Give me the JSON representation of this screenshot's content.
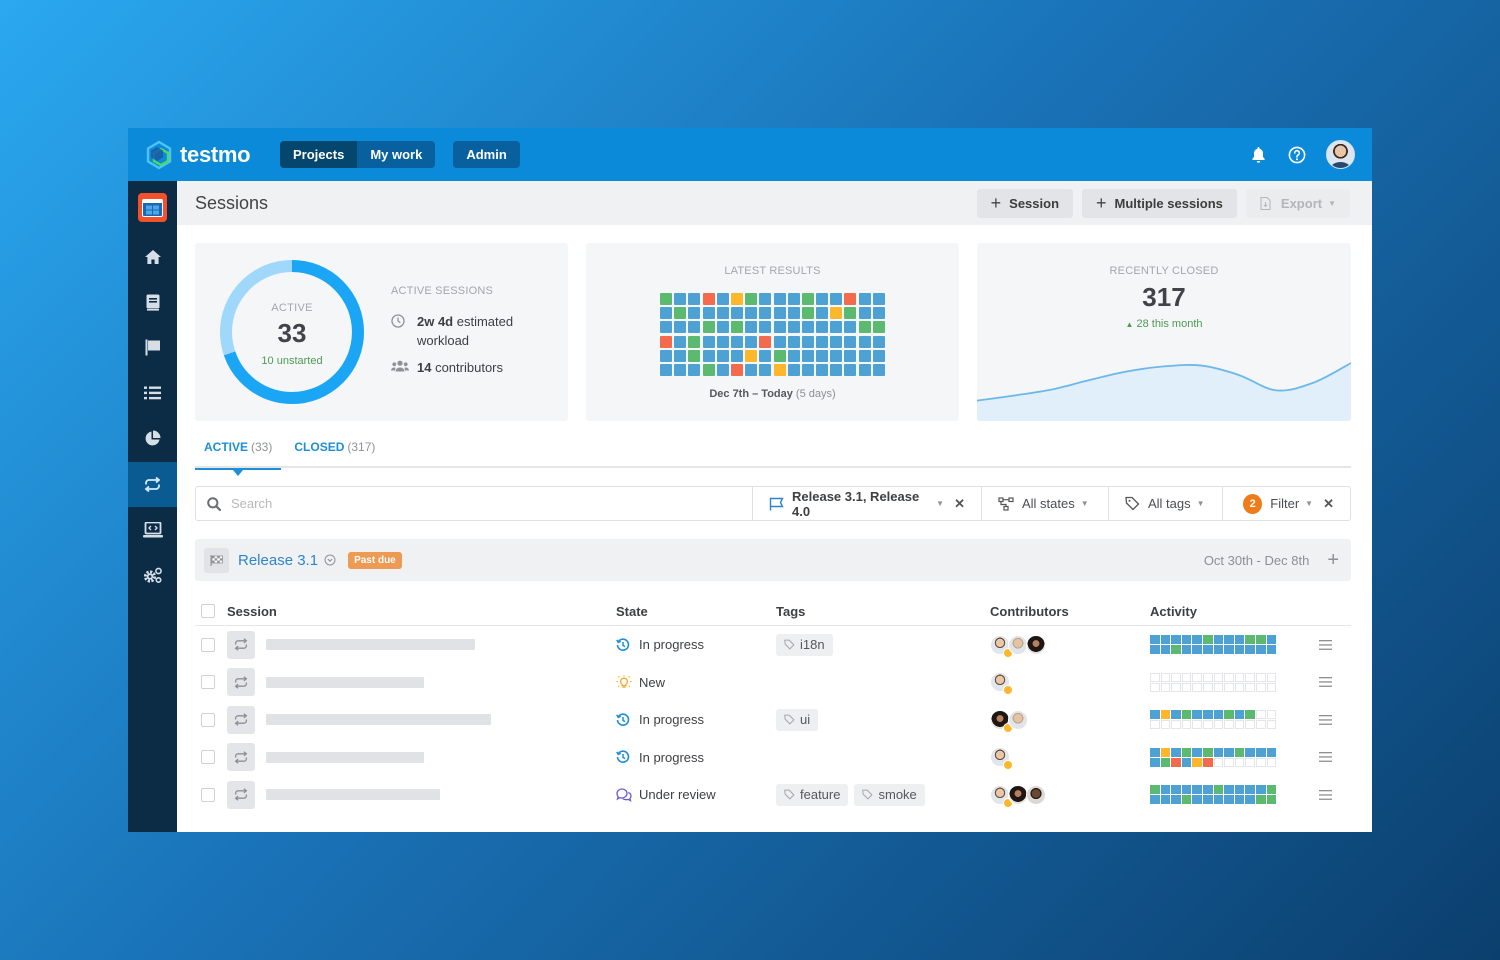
{
  "app": {
    "brand": "testmo",
    "nav": [
      {
        "label": "Projects",
        "active": true
      },
      {
        "label": "My work",
        "active": false
      }
    ],
    "admin_label": "Admin",
    "icons": [
      "bell-icon",
      "help-icon",
      "user-avatar"
    ]
  },
  "sidebar": {
    "items": [
      {
        "name": "home",
        "icon": "home-icon",
        "active": false
      },
      {
        "name": "repository",
        "icon": "book-icon",
        "active": false
      },
      {
        "name": "milestones",
        "icon": "flag-icon",
        "active": false
      },
      {
        "name": "runs",
        "icon": "list-icon",
        "active": false
      },
      {
        "name": "reports",
        "icon": "pie-chart-icon",
        "active": false
      },
      {
        "name": "sessions",
        "icon": "repeat-icon",
        "active": true
      },
      {
        "name": "automation",
        "icon": "laptop-code-icon",
        "active": false
      },
      {
        "name": "settings",
        "icon": "gears-icon",
        "active": false
      }
    ]
  },
  "header": {
    "title": "Sessions",
    "session_button": "Session",
    "multiple_sessions_button": "Multiple sessions",
    "export_button": "Export"
  },
  "active_card": {
    "caption": "ACTIVE",
    "count": "33",
    "unstarted": "10 unstarted",
    "started_fraction": 0.697,
    "title": "ACTIVE SESSIONS",
    "workload_bold": "2w 4d",
    "workload_rest": " estimated workload",
    "contributors_bold": "14",
    "contributors_rest": " contributors"
  },
  "latest_results": {
    "caption": "LATEST RESULTS",
    "date_bold": "Dec 7th – Today",
    "date_muted": " (5 days)",
    "grid": [
      "GBBRBYGBBBGBBRBB",
      "BGBBBBBBBBGBYGBB",
      "BBBGBGBBBBBBBBGG",
      "RBGBBBBRBBBBBBBB",
      "BBGBBBYBGBBBBBBB",
      "BBBGBRBBYBBBBBBB"
    ],
    "legend_colors": {
      "B": "#4ea1d3",
      "G": "#5bba6f",
      "R": "#f26b4c",
      "Y": "#fcb72b"
    }
  },
  "recently_closed": {
    "caption": "RECENTLY CLOSED",
    "count": "317",
    "delta": "28 this month",
    "trend": [
      0.18,
      0.24,
      0.31,
      0.42,
      0.52,
      0.58,
      0.59,
      0.48,
      0.3,
      0.39,
      0.62
    ]
  },
  "tabs": [
    {
      "label": "ACTIVE",
      "count": "(33)",
      "active": true
    },
    {
      "label": "CLOSED",
      "count": "(317)",
      "active": false
    }
  ],
  "filters": {
    "search_placeholder": "Search",
    "milestones": "Release 3.1, Release 4.0",
    "states": "All states",
    "tags": "All tags",
    "filter_count": "2",
    "filter_label": "Filter"
  },
  "group": {
    "title": "Release 3.1",
    "badge": "Past due",
    "dates": "Oct 30th - Dec 8th"
  },
  "table": {
    "columns": [
      "Session",
      "State",
      "Tags",
      "Contributors",
      "Activity"
    ],
    "rows": [
      {
        "title_bar_fraction": 0.64,
        "state": "In progress",
        "state_icon": "history-icon",
        "tags": [
          "i18n"
        ],
        "contributors": [
          "a",
          "b",
          "c"
        ],
        "activity": [
          "BBBBBGBBBGGB",
          "BBGBBBBBBBBB"
        ]
      },
      {
        "title_bar_fraction": 0.51,
        "state": "New",
        "state_icon": "lightbulb-icon",
        "tags": [],
        "contributors": [
          "a"
        ],
        "activity": [
          "EEEEEEEEEEEE",
          "EEEEEEEEEEEE"
        ]
      },
      {
        "title_bar_fraction": 0.68,
        "state": "In progress",
        "state_icon": "history-icon",
        "tags": [
          "ui"
        ],
        "contributors": [
          "c",
          "b"
        ],
        "activity": [
          "BYBGBBBGBGEE",
          "EEEEEEEEEEEE"
        ]
      },
      {
        "title_bar_fraction": 0.51,
        "state": "In progress",
        "state_icon": "history-icon",
        "tags": [],
        "contributors": [
          "a"
        ],
        "activity": [
          "BYBGBGBBGBBB",
          "BGRBYREEEEEE"
        ]
      },
      {
        "title_bar_fraction": 0.55,
        "state": "Under review",
        "state_icon": "comments-icon",
        "tags": [
          "feature",
          "smoke"
        ],
        "contributors": [
          "a",
          "c",
          "d"
        ],
        "activity": [
          "GBBBBBGBBBBG",
          "BBBGBBBBBBGG"
        ]
      }
    ]
  }
}
